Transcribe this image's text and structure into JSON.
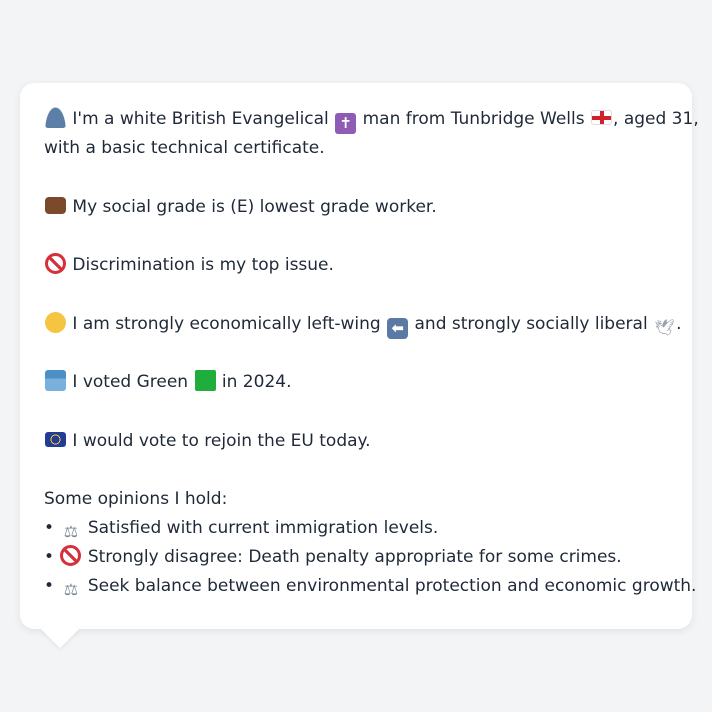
{
  "card": {
    "intro_a": "I'm a white British Evangelical",
    "intro_b": "man from Tunbridge Wells",
    "intro_c": ", aged 31,",
    "intro_d": "with a basic technical certificate.",
    "grade": "My social grade is (E) lowest grade worker.",
    "issue": "Discrimination is my top issue.",
    "econ_a": "I am strongly economically left-wing",
    "econ_b": "and strongly socially liberal",
    "econ_c": ".",
    "vote_a": "I voted Green",
    "vote_b": "in 2024.",
    "eu": "I would vote to rejoin the EU today.",
    "opinions_title": "Some opinions I hold:",
    "opinions": [
      "Satisfied with current immigration levels.",
      "Strongly disagree: Death penalty appropriate for some crimes.",
      "Seek balance between environmental protection and economic growth."
    ],
    "bullet": "•"
  },
  "icons": {
    "person": "person-icon",
    "cross": "latin-cross-icon",
    "england": "england-flag-icon",
    "briefcase": "briefcase-icon",
    "no_entry": "prohibited-icon",
    "thinking": "thinking-face-icon",
    "left_arrow": "left-arrow-icon",
    "dove": "dove-icon",
    "ballot": "ballot-box-icon",
    "green_square": "green-square-icon",
    "eu_flag": "eu-flag-icon",
    "scales": "balance-scale-icon"
  }
}
